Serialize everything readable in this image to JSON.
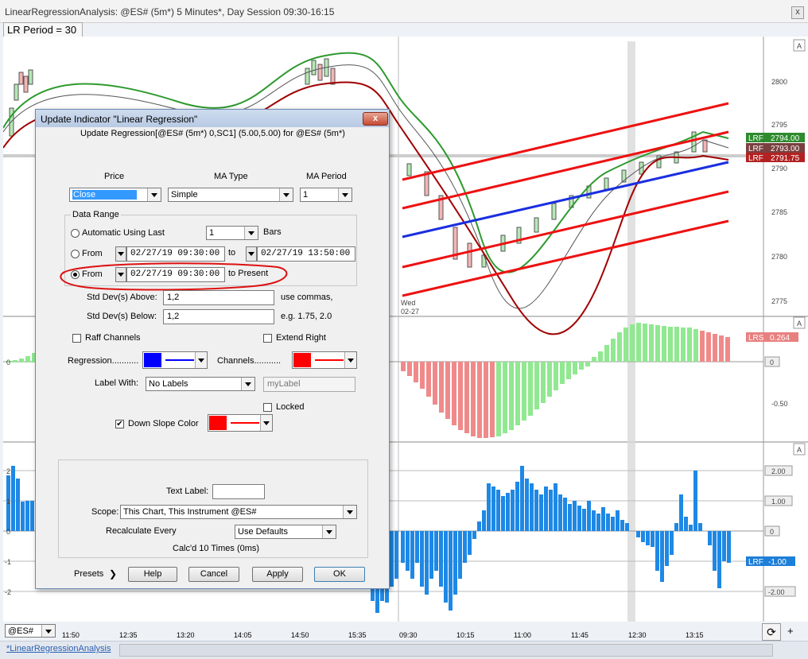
{
  "window": {
    "title": "LinearRegressionAnalysis: @ES# (5m*) 5 Minutes*, Day Session 09:30-16:15",
    "close_glyph": "x"
  },
  "lr_period_label": "LR Period = 30",
  "panes": {
    "price": {
      "autoscale_label": "A",
      "y_ticks": [
        "2800",
        "2795",
        "2790",
        "2785",
        "2780",
        "2775"
      ],
      "date_marker": [
        "Wed",
        "02-27"
      ],
      "tags": [
        {
          "label": "LRF",
          "value": "2794.00",
          "color": "#2e8b2e"
        },
        {
          "label": "LRF",
          "value": "2793.00",
          "color": "#7a4040"
        },
        {
          "label": "LRF",
          "value": "2791.75",
          "color": "#b22222"
        }
      ]
    },
    "slope": {
      "autoscale_label": "A",
      "y_ticks": [
        "0",
        "-0.50"
      ],
      "left_ticks": [
        "0"
      ],
      "tag": {
        "label": "LRS",
        "value": "0.264",
        "color": "#e88080"
      },
      "zero_tag": "0"
    },
    "stddev": {
      "autoscale_label": "A",
      "y_ticks": [
        "2.00",
        "1.00",
        "0",
        "-1.00",
        "-2.00"
      ],
      "left_ticks": [
        "2",
        "1",
        "0",
        "-1",
        "-2"
      ],
      "tag": {
        "label": "LRF",
        "value": "-1.00",
        "color": "#1e7fd8"
      }
    }
  },
  "x_axis": {
    "ticks": [
      "11:50",
      "12:35",
      "13:20",
      "14:05",
      "14:50",
      "15:35",
      "09:30",
      "10:15",
      "11:00",
      "11:45",
      "12:30",
      "13:15"
    ]
  },
  "dialog": {
    "title": "Update Indicator \"Linear Regression\"",
    "close_glyph": "x",
    "subtitle": "Update Regression[@ES# (5m*) 0,SC1] (5.00,5.00) for @ES# (5m*)",
    "price_header": "Price",
    "ma_type_header": "MA Type",
    "ma_period_header": "MA Period",
    "price_value": "Close",
    "ma_type_value": "Simple",
    "ma_period_value": "1",
    "data_range_label": "Data Range",
    "automatic_label": "Automatic Using Last",
    "bars_value": "1",
    "bars_label": "Bars",
    "from_label": "From",
    "from1_value": "02/27/19 09:30:00",
    "to_label": "to",
    "to_value": "02/27/19 13:50:00",
    "from2_value": "02/27/19 09:30:00",
    "to_present_label": "to Present",
    "stddev_above_label": "Std Dev(s) Above:",
    "stddev_above_value": "1,2",
    "use_commas": "use commas,",
    "stddev_below_label": "Std Dev(s) Below:",
    "stddev_below_value": "1,2",
    "eg_text": "e.g. 1.75, 2.0",
    "raff_label": "Raff Channels",
    "extend_right_label": "Extend Right",
    "regression_label": "Regression...........",
    "channels_label": "Channels...........",
    "regression_color": "#0000ff",
    "channels_color": "#ff0000",
    "label_with_label": "Label With:",
    "label_with_value": "No Labels",
    "label_text_value": "myLabel",
    "locked_label": "Locked",
    "down_slope_label": "Down Slope Color",
    "down_slope_checked": "✔",
    "down_slope_color": "#ff0000",
    "text_label_label": "Text Label:",
    "scope_label": "Scope:",
    "scope_value": "This Chart, This Instrument @ES#",
    "recalc_label": "Recalculate Every",
    "recalc_value": "Use Defaults",
    "calcd_text": "Calc'd 10 Times (0ms)",
    "presets_label": "Presets",
    "help_label": "Help",
    "cancel_label": "Cancel",
    "apply_label": "Apply",
    "ok_label": "OK"
  },
  "bottom": {
    "symbol": "@ES#",
    "tab_label": "*LinearRegressionAnalysis",
    "plus": "+"
  }
}
